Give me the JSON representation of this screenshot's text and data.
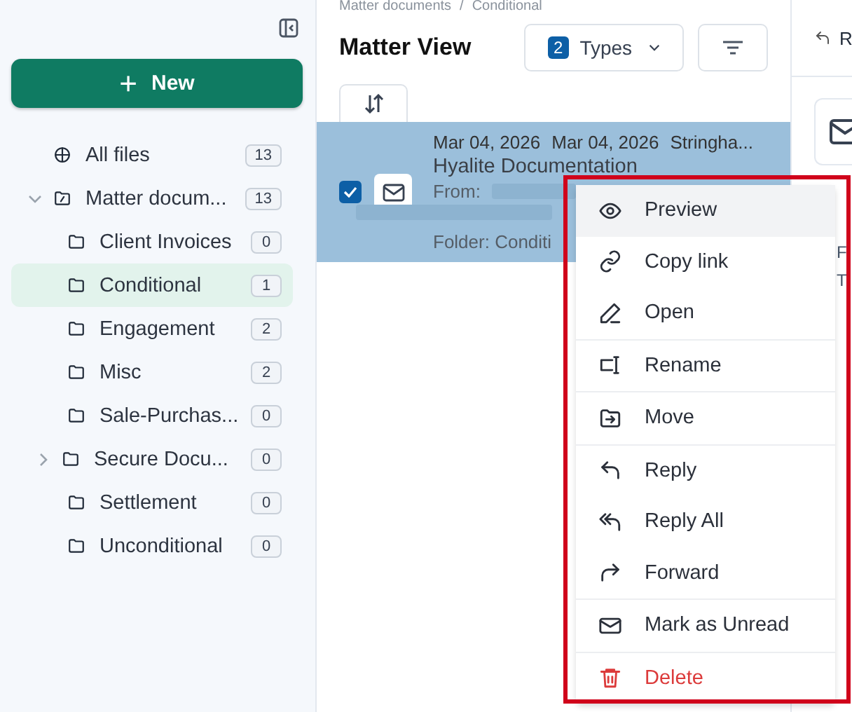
{
  "sidebar": {
    "new_button": {
      "label": "New",
      "icon": "+"
    },
    "tree": [
      {
        "label": "All files",
        "count": "13",
        "kind": "globe",
        "selected": false
      },
      {
        "label": "Matter docum...",
        "count": "13",
        "kind": "root",
        "selected": false,
        "expanded": true,
        "children": [
          {
            "label": "Client Invoices",
            "count": "0",
            "kind": "folder",
            "selected": false
          },
          {
            "label": "Conditional",
            "count": "1",
            "kind": "folder",
            "selected": true
          },
          {
            "label": "Engagement",
            "count": "2",
            "kind": "folder",
            "selected": false
          },
          {
            "label": "Misc",
            "count": "2",
            "kind": "folder",
            "selected": false
          },
          {
            "label": "Sale-Purchas...",
            "count": "0",
            "kind": "folder",
            "selected": false
          },
          {
            "label": "Secure Docu...",
            "count": "0",
            "kind": "folder",
            "selected": false,
            "expanded": false
          },
          {
            "label": "Settlement",
            "count": "0",
            "kind": "folder",
            "selected": false
          },
          {
            "label": "Unconditional",
            "count": "0",
            "kind": "folder",
            "selected": false
          }
        ]
      }
    ]
  },
  "main": {
    "breadcrumb": {
      "items": [
        "Matter documents",
        "Conditional"
      ],
      "separator": "/"
    },
    "title": "Matter View",
    "types_filter": {
      "count": "2",
      "label": "Types"
    },
    "rows": [
      {
        "checked": true,
        "selected": true,
        "date_1": "Mar 04, 2026",
        "date_2": "Mar 04, 2026",
        "author": "Stringha...",
        "title": "Hyalite Documentation",
        "from_label": "From:",
        "folder": "Folder: Conditi"
      }
    ]
  },
  "context_menu": {
    "groups": [
      [
        {
          "label": "Preview",
          "kind": "eye",
          "highlighted": true
        },
        {
          "label": "Copy link",
          "kind": "link",
          "highlighted": false
        },
        {
          "label": "Open",
          "kind": "pen",
          "highlighted": false
        }
      ],
      [
        {
          "label": "Rename",
          "kind": "rename",
          "highlighted": false
        }
      ],
      [
        {
          "label": "Move",
          "kind": "move",
          "highlighted": false
        }
      ],
      [
        {
          "label": "Reply",
          "kind": "reply",
          "highlighted": false
        },
        {
          "label": "Reply All",
          "kind": "replyall",
          "highlighted": false
        },
        {
          "label": "Forward",
          "kind": "forward",
          "highlighted": false
        }
      ],
      [
        {
          "label": "Mark as Unread",
          "kind": "mail",
          "highlighted": false
        }
      ],
      [
        {
          "label": "Delete",
          "kind": "trash",
          "highlighted": false
        }
      ]
    ]
  },
  "preview_panel": {
    "action_label": "R",
    "from_label": "F",
    "to_label": "T"
  }
}
